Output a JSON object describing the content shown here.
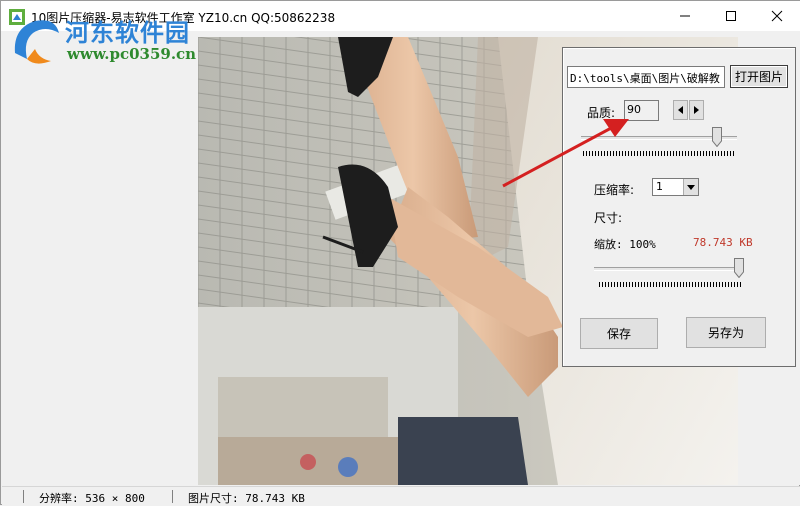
{
  "window": {
    "title": "10图片压缩器-易志软件工作室 YZ10.cn   QQ:50862238"
  },
  "watermark": {
    "line1": "河东软件园",
    "line2": "www.pc0359.cn"
  },
  "panel": {
    "path_value": "D:\\tools\\桌面\\图片\\破解教",
    "open_button": "打开图片",
    "quality_label": "品质:",
    "quality_value": "90",
    "quality_slider_fraction": 0.9,
    "compression_label": "压缩率:",
    "compression_value": "1",
    "size_label": "尺寸:",
    "zoom_label": "缩放: 100%",
    "file_size": "78.743 KB",
    "zoom_slider_fraction": 1.0,
    "save_button": "保存",
    "save_as_button": "另存为"
  },
  "statusbar": {
    "resolution": "分辨率: 536 × 800",
    "image_size": "图片尺寸: 78.743 KB"
  },
  "colors": {
    "file_size_text": "#c0392b",
    "annotation_arrow": "#d42020"
  },
  "icons": [
    "app-icon",
    "minimize-icon",
    "maximize-icon",
    "close-icon",
    "spin-left-icon",
    "spin-right-icon",
    "dropdown-arrow-icon"
  ]
}
